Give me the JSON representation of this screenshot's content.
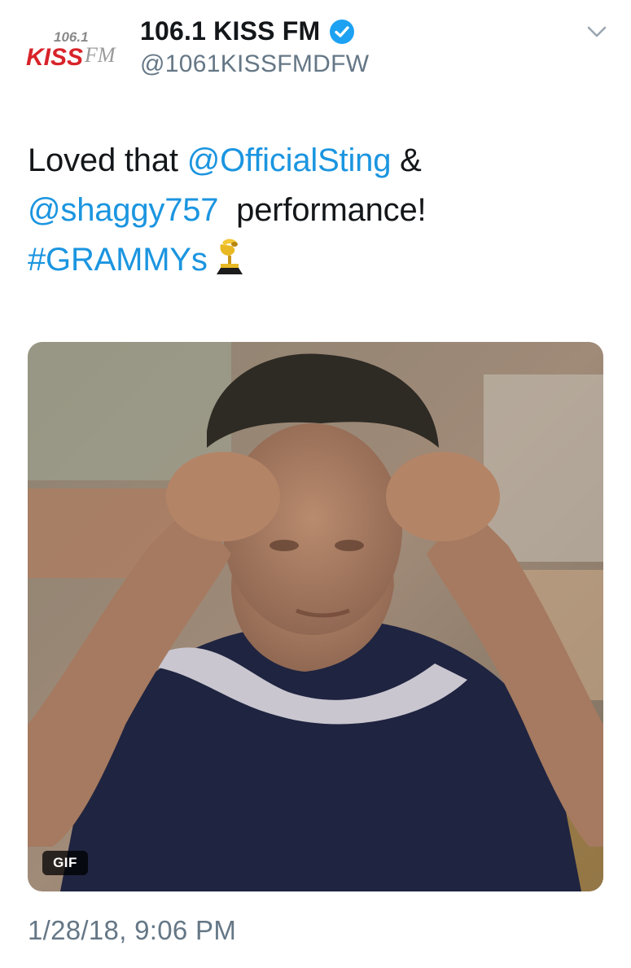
{
  "account": {
    "display_name": "106.1 KISS FM",
    "handle": "@1061KISSFMDFW",
    "verified": true,
    "avatar_logo": {
      "top_text": "106.1",
      "main_text": "KISS",
      "sub_text": "FM",
      "icon": "kissfm-logo"
    }
  },
  "tweet": {
    "text_1": "Loved that ",
    "mention_1": "@OfficialSting",
    "text_2": " &",
    "mention_2": "@shaggy757",
    "text_3": "  performance!",
    "hashtag": "#GRAMMYs",
    "emoji": "grammy-trophy-icon"
  },
  "media": {
    "type": "gif",
    "badge": "GIF",
    "description_icon": "animated-gif-image"
  },
  "timestamp": "1/28/18, 9:06 PM",
  "colors": {
    "link": "#1b95e0",
    "secondary": "#657786",
    "text": "#14171a",
    "verified": "#1da1f2"
  }
}
